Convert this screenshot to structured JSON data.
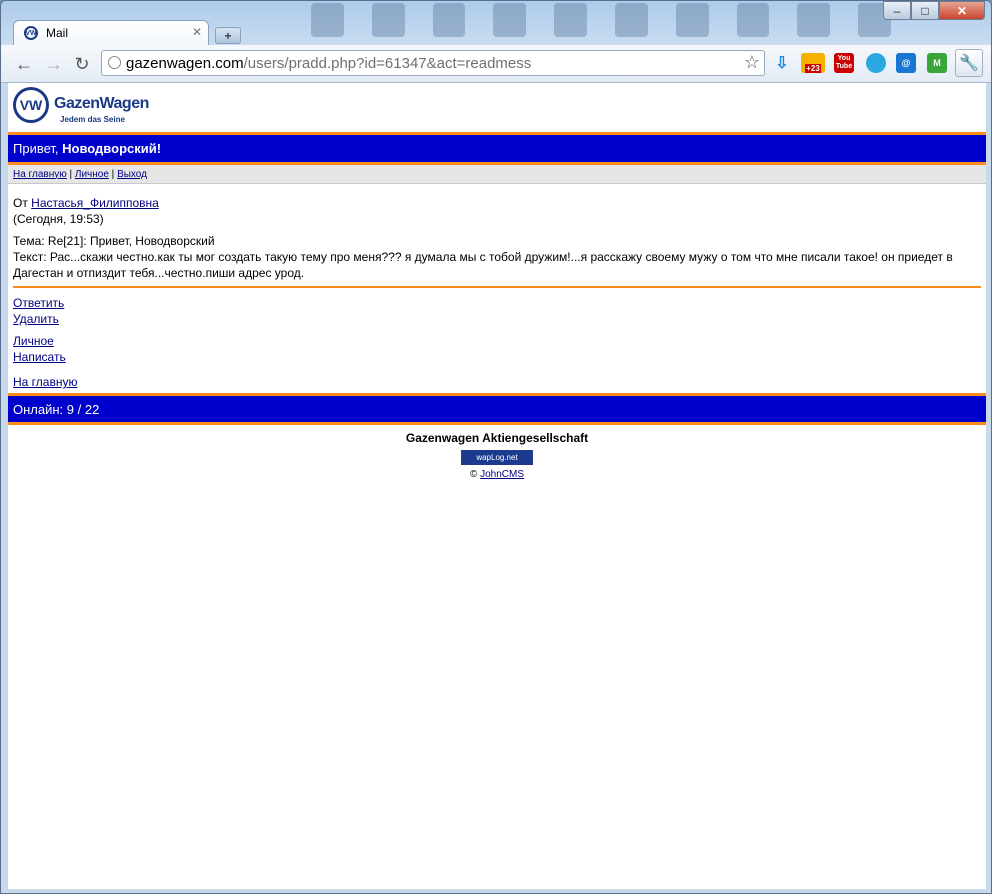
{
  "browser": {
    "tab_title": "Mail",
    "url_domain": "gazenwagen.com",
    "url_path": "/users/pradd.php?id=61347&act=readmess",
    "ext_weather_badge": "+23",
    "ext_youtube_label": "You Tube"
  },
  "site": {
    "logo_name": "GazenWagen",
    "logo_tagline": "Jedem das Seine",
    "greeting_prefix": "Привет, ",
    "greeting_name": "Новодворский!",
    "menu": {
      "home": "На главную",
      "personal": "Личное",
      "logout": "Выход",
      "sep": " | "
    }
  },
  "message": {
    "from_label": "От ",
    "from_user": "Настасья_Филипповна",
    "time": "(Сегодня, 19:53)",
    "subject_label": "Тема: ",
    "subject": "Re[21]: Привет, Новодворский",
    "text_label": "Текст: ",
    "text": "Рас...скажи честно.как ты мог создать такую тему про меня??? я думала мы с тобой дружим!...я расскажу своему мужу о том что мне писали такое! он приедет в Дагестан и отпиздит тебя...честно.пиши адрес урод."
  },
  "actions": {
    "reply": "Ответить",
    "delete": "Удалить",
    "personal": "Личное",
    "write": "Написать",
    "home": "На главную"
  },
  "footer": {
    "online": "Онлайн: 9 / 22",
    "company": "Gazenwagen Aktiengesellschaft",
    "counter_badge": "wapLog.net",
    "copyright_symbol": "© ",
    "copyright_link": "JohnCMS"
  }
}
